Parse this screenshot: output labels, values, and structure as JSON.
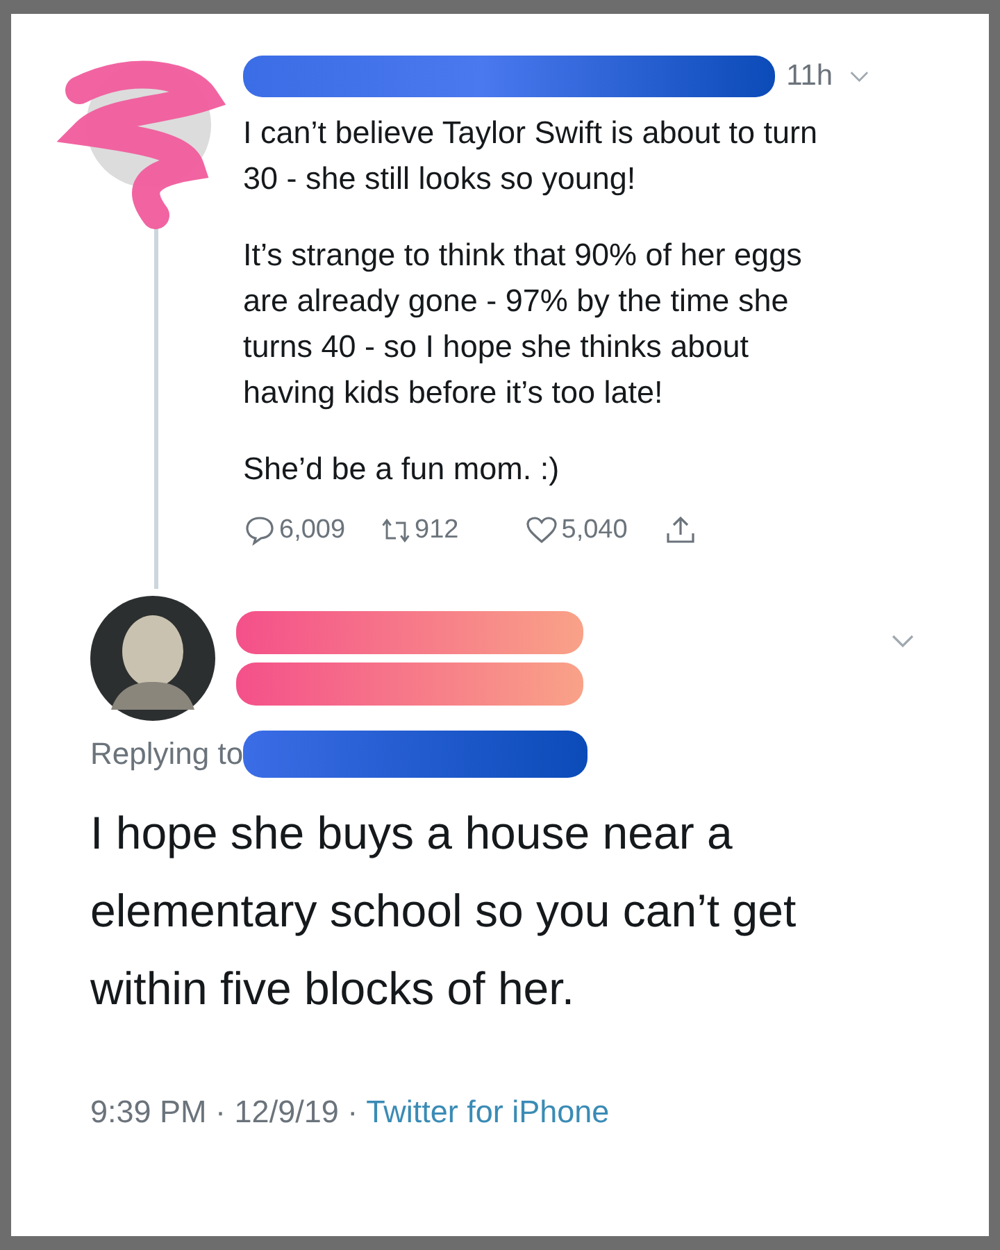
{
  "tweet": {
    "time": "11h",
    "paragraphs": [
      "I can’t believe Taylor Swift is about to turn 30 - she still looks so young!",
      "It’s strange to think that 90% of her eggs are already gone - 97% by the time she turns 40 - so I hope she thinks about having kids before it’s too late!",
      "She’d be a fun mom. :)"
    ],
    "actions": [
      {
        "kind": "reply",
        "count": "6,009"
      },
      {
        "kind": "retweet",
        "count": "912"
      },
      {
        "kind": "like",
        "count": "5,040"
      },
      {
        "kind": "share"
      }
    ]
  },
  "reply": {
    "replying_label": "Replying to",
    "text": "I hope she buys a house near a elementary school so you can’t get within five blocks of her.",
    "meta": "9:39 PM · 12/9/19 ·",
    "source": "Twitter for iPhone"
  }
}
